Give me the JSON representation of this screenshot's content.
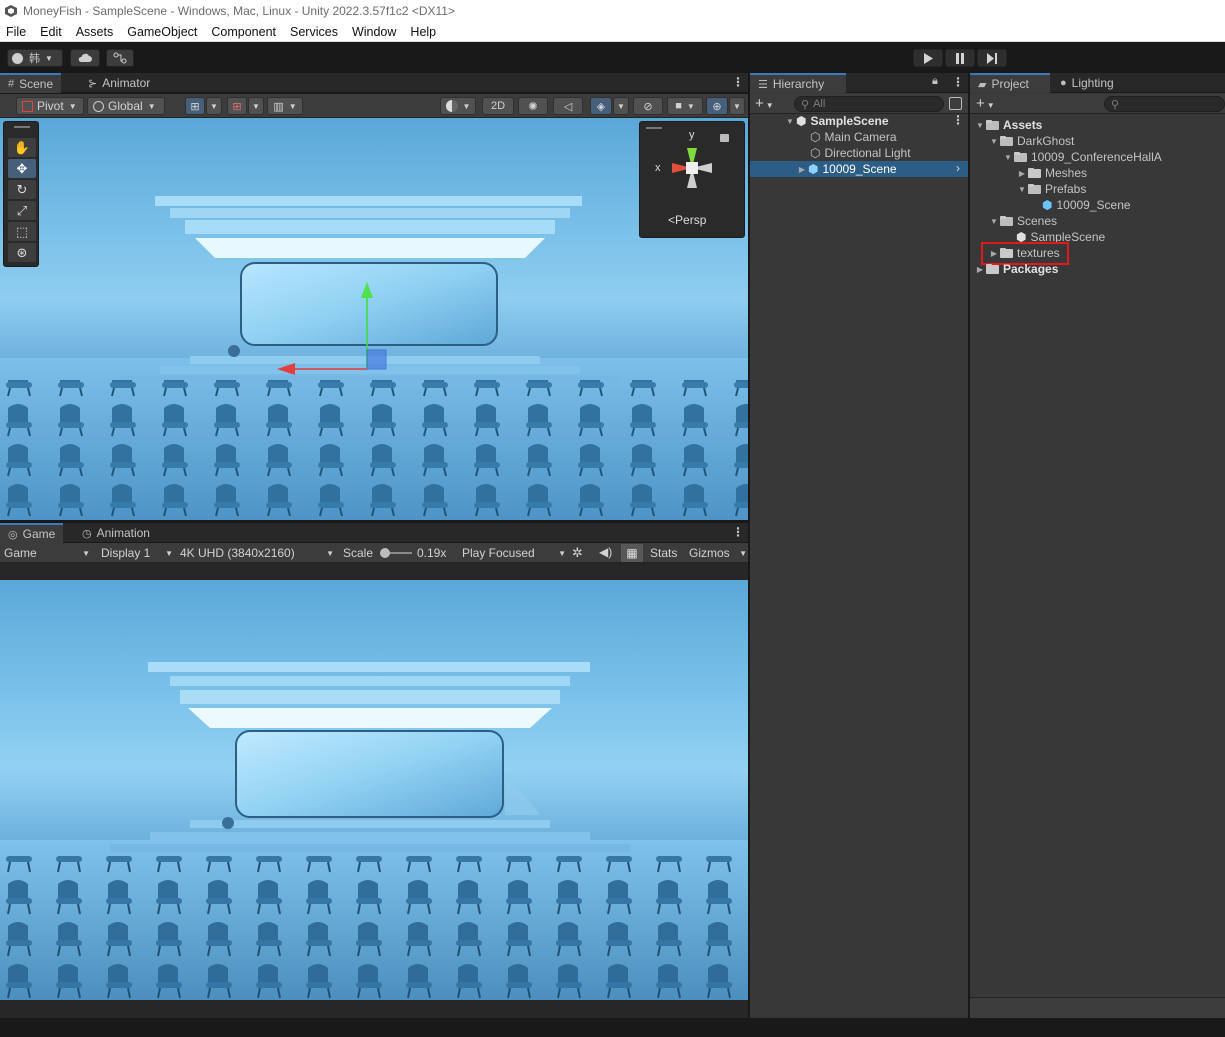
{
  "window": {
    "title": "MoneyFish - SampleScene - Windows, Mac, Linux - Unity 2022.3.57f1c2 <DX11>"
  },
  "menu": [
    "File",
    "Edit",
    "Assets",
    "GameObject",
    "Component",
    "Services",
    "Window",
    "Help"
  ],
  "toolbar": {
    "account_label": "韩"
  },
  "scene_panel": {
    "tabs": [
      "Scene",
      "Animator"
    ],
    "pivot_label": "Pivot",
    "global_label": "Global",
    "mode_2d_label": "2D",
    "gizmo_persp_label": "Persp",
    "axis_x": "x",
    "axis_y": "y"
  },
  "game_panel": {
    "tabs": [
      "Game",
      "Animation"
    ],
    "game_dropdown": "Game",
    "display_dropdown": "Display 1",
    "resolution_dropdown": "4K UHD (3840x2160)",
    "scale_label": "Scale",
    "scale_value": "0.19x",
    "play_mode_dropdown": "Play Focused",
    "stats_label": "Stats",
    "gizmos_label": "Gizmos"
  },
  "hierarchy": {
    "tab": "Hierarchy",
    "search_placeholder": "All",
    "items": [
      {
        "label": "SampleScene"
      },
      {
        "label": "Main Camera"
      },
      {
        "label": "Directional Light"
      },
      {
        "label": "10009_Scene"
      }
    ]
  },
  "project": {
    "tabs": [
      "Project",
      "Lighting"
    ],
    "tree": [
      {
        "label": "Assets"
      },
      {
        "label": "DarkGhost"
      },
      {
        "label": "10009_ConferenceHallA"
      },
      {
        "label": "Meshes"
      },
      {
        "label": "Prefabs"
      },
      {
        "label": "10009_Scene"
      },
      {
        "label": "Scenes"
      },
      {
        "label": "SampleScene"
      },
      {
        "label": "textures"
      },
      {
        "label": "Packages"
      }
    ]
  },
  "colors": {
    "accent": "#3a79bb",
    "selection": "#2c5d87",
    "highlight_box": "#e01a1a",
    "panel": "#383838"
  }
}
